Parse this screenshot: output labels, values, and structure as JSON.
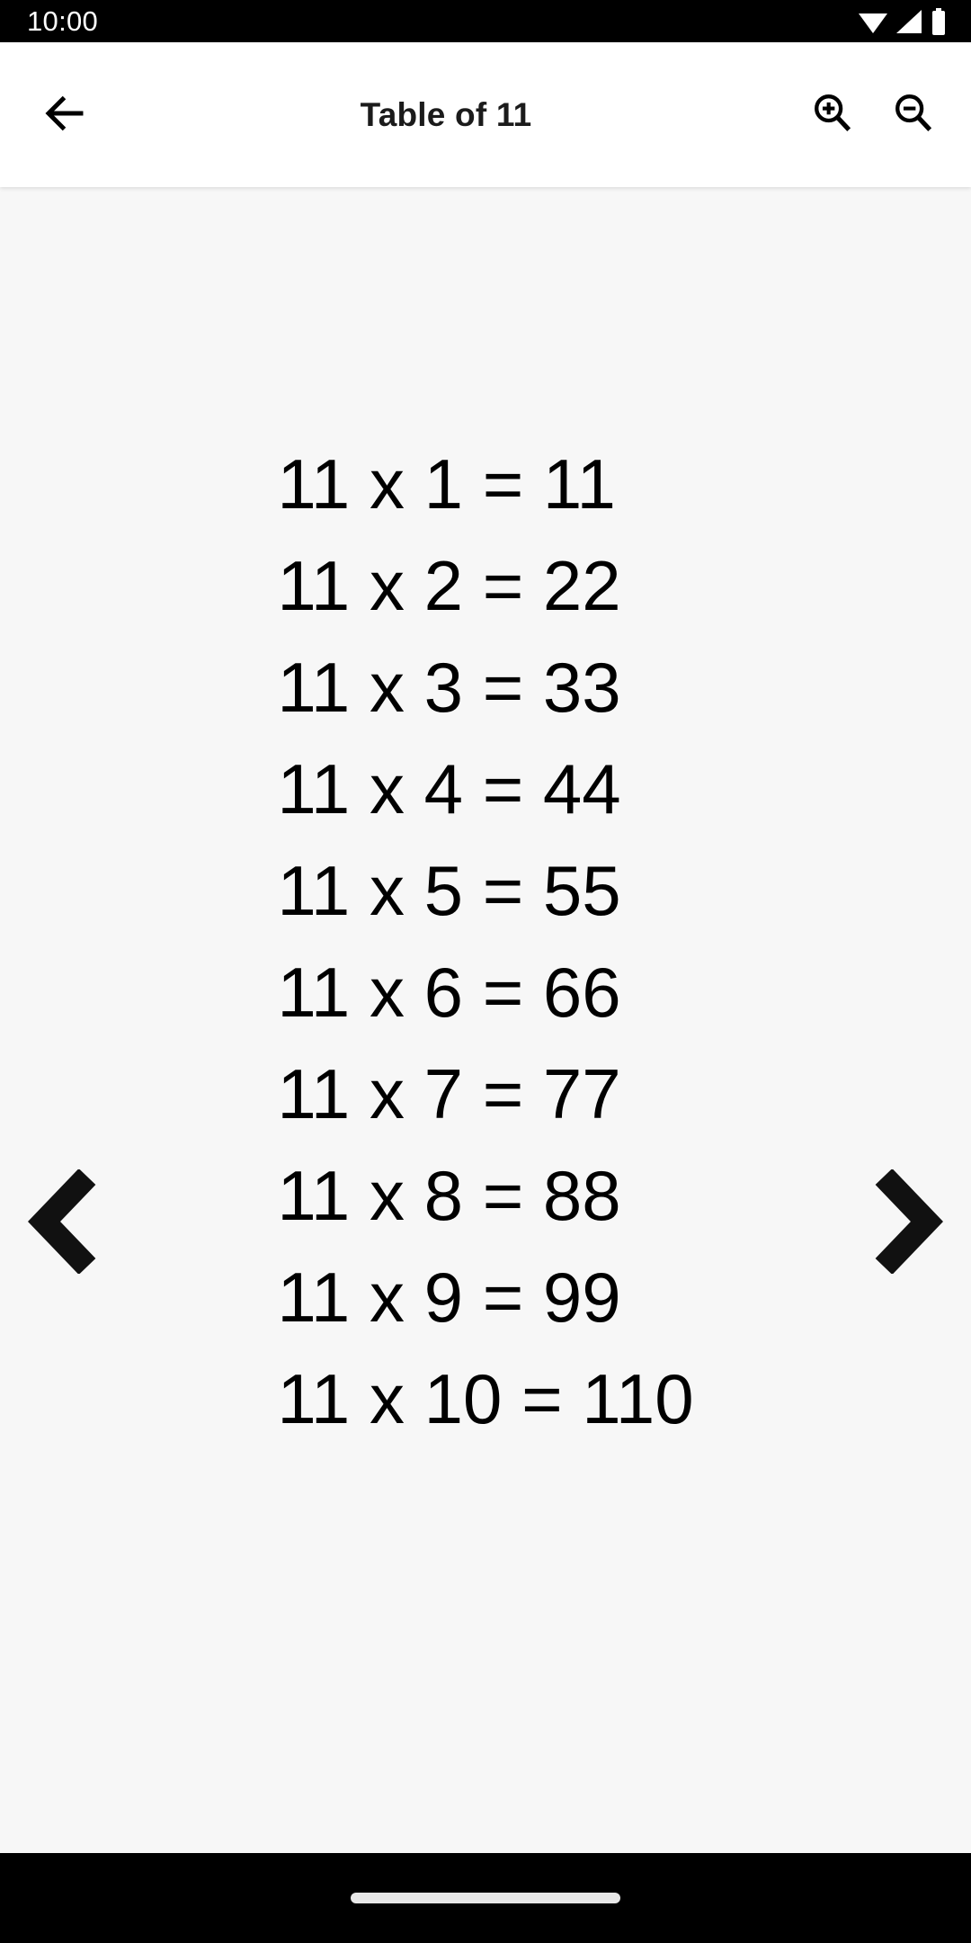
{
  "status_bar": {
    "time": "10:00",
    "icons": [
      "wifi-icon",
      "cellular-signal-icon",
      "battery-icon"
    ]
  },
  "app_bar": {
    "back_label": "back-arrow-icon",
    "title": "Table of 11",
    "zoom_in_label": "zoom-in-icon",
    "zoom_out_label": "zoom-out-icon"
  },
  "navigation": {
    "prev_label": "chevron-left-icon",
    "next_label": "chevron-right-icon"
  },
  "table": {
    "base": 11,
    "rows": [
      "11 x 1 = 11",
      "11 x 2 = 22",
      "11 x 3 = 33",
      "11 x 4 = 44",
      "11 x 5 = 55",
      "11 x 6 = 66",
      "11 x 7 = 77",
      "11 x 8 = 88",
      "11 x 9 = 99",
      "11 x 10 = 110"
    ]
  },
  "colors": {
    "status_bar_bg": "#000000",
    "app_bar_bg": "#ffffff",
    "content_bg": "#f7f7f7",
    "text": "#000000",
    "gesture_bar_bg": "#000000",
    "home_indicator": "#e8e8e8"
  }
}
